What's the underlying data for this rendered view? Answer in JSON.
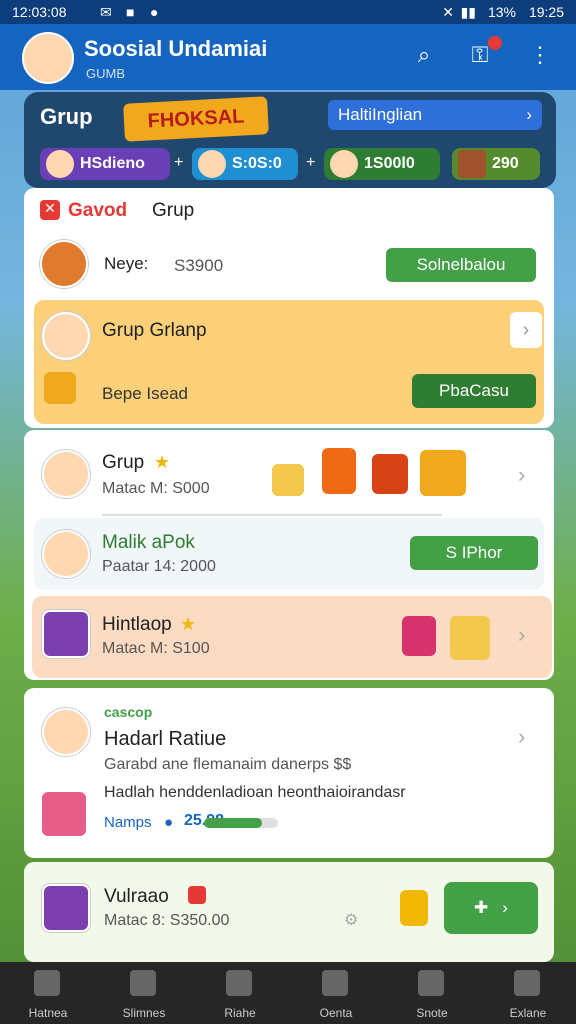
{
  "status": {
    "time": "12:03:08",
    "battery": "19:25",
    "percent": "13%"
  },
  "appbar": {
    "title": "Soosial Undamiai",
    "subtitle": "GUMB",
    "search_icon": "search-icon",
    "key_icon": "key-icon",
    "more_icon": "more-vertical-icon"
  },
  "hero": {
    "label": "Grup",
    "banner": "FHOKSAL",
    "pill": "HaltiInglian",
    "chips": [
      {
        "label": "HSdieno"
      },
      {
        "label": "S:0S:0"
      },
      {
        "label": "1S00l0"
      },
      {
        "label": "290"
      }
    ]
  },
  "card1": {
    "header": "Gavod",
    "header2": "Grup",
    "row1_text": "Neye:",
    "row1_value": "S3900",
    "row1_button": "Solnelbalou",
    "row2_title": "Grup Grlanp",
    "row2_sub": "Bepe Isead",
    "row2_button": "PbaCasu"
  },
  "card2": {
    "row1_title": "Grup",
    "row1_sub": "Matac M: S000",
    "row2_title": "Malik aPok",
    "row2_sub": "Paatar 14: 2000",
    "row2_button": "S IPhor",
    "row3_title": "Hintlaop",
    "row3_sub": "Matac M: S100"
  },
  "card3": {
    "tag": "cascop",
    "title": "Hadarl Ratiue",
    "line1": "Garabd ane flemanaim danerps $$",
    "line2": "Hadlah henddenladioan heonthaioirandasr",
    "progress_label": "Namps",
    "progress_value": "25.98",
    "progress": 0.78
  },
  "card4": {
    "title": "Vulraao",
    "sub": "Matac 8: S350.00"
  },
  "nav": [
    {
      "label": "Hatnea",
      "icon": "home-icon"
    },
    {
      "label": "Slimnes",
      "icon": "chat-icon"
    },
    {
      "label": "Riahe",
      "icon": "bird-icon"
    },
    {
      "label": "Oenta",
      "icon": "house-icon"
    },
    {
      "label": "Snote",
      "icon": "search-icon"
    },
    {
      "label": "Exlane",
      "icon": "user-icon"
    }
  ]
}
